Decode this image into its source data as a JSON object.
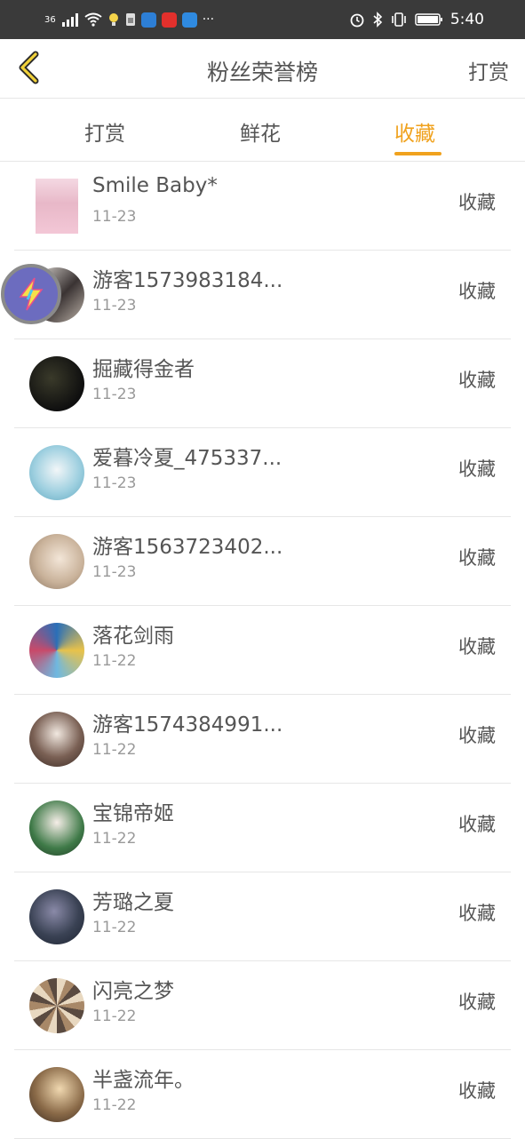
{
  "status_bar": {
    "signal_label": "36",
    "time": "5:40",
    "more": "···",
    "icons": [
      "signal-icon",
      "wifi-icon",
      "bulb-icon",
      "sim-icon",
      "k-app-icon",
      "s-app-icon",
      "q-app-icon",
      "alarm-icon",
      "bluetooth-icon",
      "vibrate-icon",
      "battery-icon"
    ]
  },
  "header": {
    "back_icon": "chevron-left-icon",
    "title": "粉丝荣誉榜",
    "action": "打赏"
  },
  "tabs": [
    {
      "label": "打赏",
      "active": false
    },
    {
      "label": "鲜花",
      "active": false
    },
    {
      "label": "收藏",
      "active": true
    }
  ],
  "colors": {
    "accent": "#f0a21e"
  },
  "fans": [
    {
      "name": "Smile Baby*",
      "date": "11-23",
      "action": "收藏"
    },
    {
      "name": "游客1573983184...",
      "date": "11-23",
      "action": "收藏"
    },
    {
      "name": "掘藏得金者",
      "date": "11-23",
      "action": "收藏"
    },
    {
      "name": "爱暮冷夏_475337...",
      "date": "11-23",
      "action": "收藏"
    },
    {
      "name": "游客1563723402...",
      "date": "11-23",
      "action": "收藏"
    },
    {
      "name": "落花剑雨",
      "date": "11-22",
      "action": "收藏"
    },
    {
      "name": "游客1574384991...",
      "date": "11-22",
      "action": "收藏"
    },
    {
      "name": "宝锦帝姬",
      "date": "11-22",
      "action": "收藏"
    },
    {
      "name": "芳璐之夏",
      "date": "11-22",
      "action": "收藏"
    },
    {
      "name": "闪亮之梦",
      "date": "11-22",
      "action": "收藏"
    },
    {
      "name": "半盏流年。",
      "date": "11-22",
      "action": "收藏"
    }
  ],
  "floating_button_icon": "lightning-icon"
}
